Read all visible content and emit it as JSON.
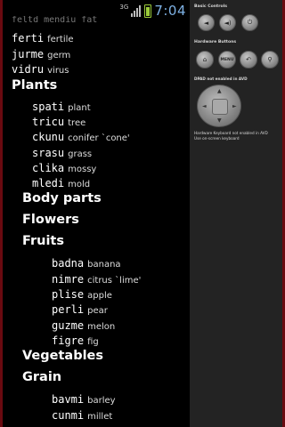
{
  "status_bar": {
    "network": "3G",
    "time": "7:04"
  },
  "list": {
    "cutoff_text": "feltd  mendiu  fat",
    "entries_top": [
      {
        "word": "ferti",
        "gloss": "fertile"
      },
      {
        "word": "jurme",
        "gloss": "germ"
      },
      {
        "word": "vidru",
        "gloss": "virus"
      }
    ],
    "plants": {
      "label": "Plants",
      "entries": [
        {
          "word": "spati",
          "gloss": "plant"
        },
        {
          "word": "tricu",
          "gloss": "tree"
        },
        {
          "word": "ckunu",
          "gloss": "conifer `cone'"
        },
        {
          "word": "srasu",
          "gloss": "grass"
        },
        {
          "word": "clika",
          "gloss": "mossy"
        },
        {
          "word": "mledi",
          "gloss": "mold"
        }
      ]
    },
    "body_parts": {
      "label": "Body parts"
    },
    "flowers": {
      "label": "Flowers"
    },
    "fruits": {
      "label": "Fruits",
      "entries": [
        {
          "word": "badna",
          "gloss": "banana"
        },
        {
          "word": "nimre",
          "gloss": "citrus `lime'"
        },
        {
          "word": "plise",
          "gloss": "apple"
        },
        {
          "word": "perli",
          "gloss": "pear"
        },
        {
          "word": "guzme",
          "gloss": "melon"
        },
        {
          "word": "figre",
          "gloss": "fig"
        }
      ]
    },
    "vegetables": {
      "label": "Vegetables"
    },
    "grain": {
      "label": "Grain",
      "entries": [
        {
          "word": "bavmi",
          "gloss": "barley"
        },
        {
          "word": "cunmi",
          "gloss": "millet"
        }
      ]
    }
  },
  "emulator_panel": {
    "basic_controls": "Basic Controls",
    "hardware_buttons": "Hardware Buttons",
    "menu": "MENU",
    "dpad_note": "DPAD not enabled in AVD",
    "keyboard_note_1": "Hardware Keyboard not enabled in AVD",
    "keyboard_note_2": "Use on-screen keyboard"
  }
}
